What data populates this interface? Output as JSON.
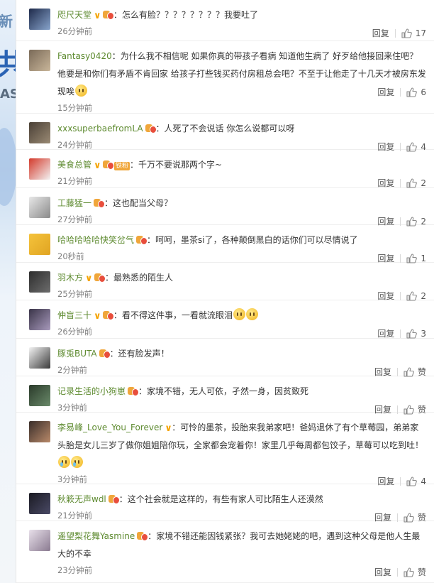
{
  "background": {
    "fragments": [
      "新",
      "共",
      "AS"
    ]
  },
  "actions": {
    "reply_label": "回复",
    "like_icon": "thumbs-up-icon"
  },
  "comments": [
    {
      "user": "咫尺天堂",
      "badges": [
        "v",
        "level"
      ],
      "text": "：怎么有脸？？？？？？？？我要吐了",
      "time": "26分钟前",
      "likes": "17",
      "avatar_colors": [
        "#1e2a4a",
        "#88a4cc"
      ]
    },
    {
      "user": "Fantasy0420",
      "badges": [],
      "text": "：为什么我不相信呢 如果你真的带孩子看病 知道他生病了 好歹给他接回来住吧？他要是和你们有矛盾不肯回家 给孩子打些钱买药付房租总会吧？不至于让他走了十几天才被房东发现唉",
      "emojis": [
        "sad"
      ],
      "time": "15分钟前",
      "likes": "6",
      "avatar_colors": [
        "#7a6a58",
        "#c9b69a"
      ]
    },
    {
      "user": "xxxsuperbaefromLA",
      "badges": [
        "level"
      ],
      "text": "：人死了不会说话 你怎么说都可以呀",
      "time": "24分钟前",
      "likes": "4",
      "avatar_colors": [
        "#4a4036",
        "#9a8a74"
      ]
    },
    {
      "user": "美食总管",
      "badges": [
        "v",
        "level",
        "fan"
      ],
      "fan_label": "铁粉",
      "text": "：千万不要说那两个字~",
      "time": "21分钟前",
      "likes": "2",
      "avatar_colors": [
        "#d33a2c",
        "#f3f3f3"
      ]
    },
    {
      "user": "工藤猛一",
      "badges": [
        "level"
      ],
      "text": "：这也配当父母？",
      "time": "27分钟前",
      "likes": "2",
      "avatar_colors": [
        "#e8e8e8",
        "#8a8a8a"
      ]
    },
    {
      "user": "哈哈哈哈哈快笑岔气",
      "badges": [
        "level"
      ],
      "text": "：呵呵，墨茶si了，各种颠倒黑白的话你们可以尽情说了",
      "time": "20秒前",
      "likes": "1",
      "avatar_colors": [
        "#f5c33b",
        "#e0a422"
      ]
    },
    {
      "user": "羽木方",
      "badges": [
        "v",
        "level"
      ],
      "text": "：最熟悉的陌生人",
      "time": "25分钟前",
      "likes": "2",
      "avatar_colors": [
        "#2d2d2d",
        "#6d6d6d"
      ]
    },
    {
      "user": "仲盲三十",
      "badges": [
        "v",
        "level"
      ],
      "text": "：看不得这件事，一看就流眼泪",
      "emojis": [
        "sad",
        "sad"
      ],
      "time": "26分钟前",
      "likes": "3",
      "avatar_colors": [
        "#3a3448",
        "#a89abc"
      ]
    },
    {
      "user": "豚兎BUTA",
      "badges": [
        "level"
      ],
      "text": "：还有脸发声！",
      "time": "2分钟前",
      "likes": "赞",
      "avatar_colors": [
        "#f3f3f3",
        "#3a3a3a"
      ]
    },
    {
      "user": "记录生活的小狗崽",
      "badges": [
        "level"
      ],
      "text": "：家境不错，无人可依，孑然一身，因贫致死",
      "time": "3分钟前",
      "likes": "赞",
      "avatar_colors": [
        "#2a3a2a",
        "#6a8a6a"
      ]
    },
    {
      "user": "李易峰_Love_You_Forever",
      "badges": [
        "v"
      ],
      "text": "：可怜的墨茶，投胎来我弟家吧！爸妈退休了有个草莓园，弟弟家头胎是女儿三岁了做你姐姐陪你玩，全家都会宠着你！家里几乎每周都包饺子，草莓可以吃到吐！",
      "emojis": [
        "tear",
        "tear"
      ],
      "time": "3分钟前",
      "likes": "4",
      "avatar_colors": [
        "#3a2e2a",
        "#b98a6a"
      ]
    },
    {
      "user": "秋簌无声wdl",
      "badges": [
        "level"
      ],
      "text": "：这个社会就是这样的，有些有家人可比陌生人还漠然",
      "time": "21分钟前",
      "likes": "赞",
      "avatar_colors": [
        "#1a1a22",
        "#4a4a66"
      ]
    },
    {
      "user": "遥望梨花舞Yasmine",
      "badges": [
        "level"
      ],
      "text": "：家境不错还能因钱紧张？我可去她姥姥的吧，遇到这种父母是他人生最大的不幸",
      "time": "23分钟前",
      "likes": "赞",
      "avatar_colors": [
        "#e8e0ea",
        "#8a7a90"
      ]
    }
  ]
}
